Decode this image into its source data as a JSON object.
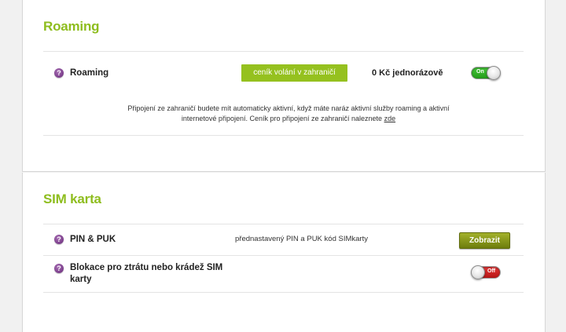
{
  "roaming": {
    "section_title": "Roaming",
    "row_label": "Roaming",
    "rates_button": "ceník volání v zahraničí",
    "price": "0 Kč jednorázově",
    "toggle_label": "On",
    "info_text_1": "Připojení ze zahraničí budete mít automaticky aktivní, když máte naráz aktivní služby roaming a aktivní",
    "info_text_2": "internetové připojení. Ceník pro připojení ze zahraničí naleznete",
    "info_link": "zde"
  },
  "sim": {
    "section_title": "SIM karta",
    "pin_label": "PIN & PUK",
    "pin_description": "přednastavený PIN a PUK kód SIMkarty",
    "show_button": "Zobrazit",
    "block_label_1": "Blokace pro ztrátu nebo krádež SIM",
    "block_label_2": "karty",
    "toggle_label": "Off"
  },
  "icons": {
    "help": "?"
  }
}
